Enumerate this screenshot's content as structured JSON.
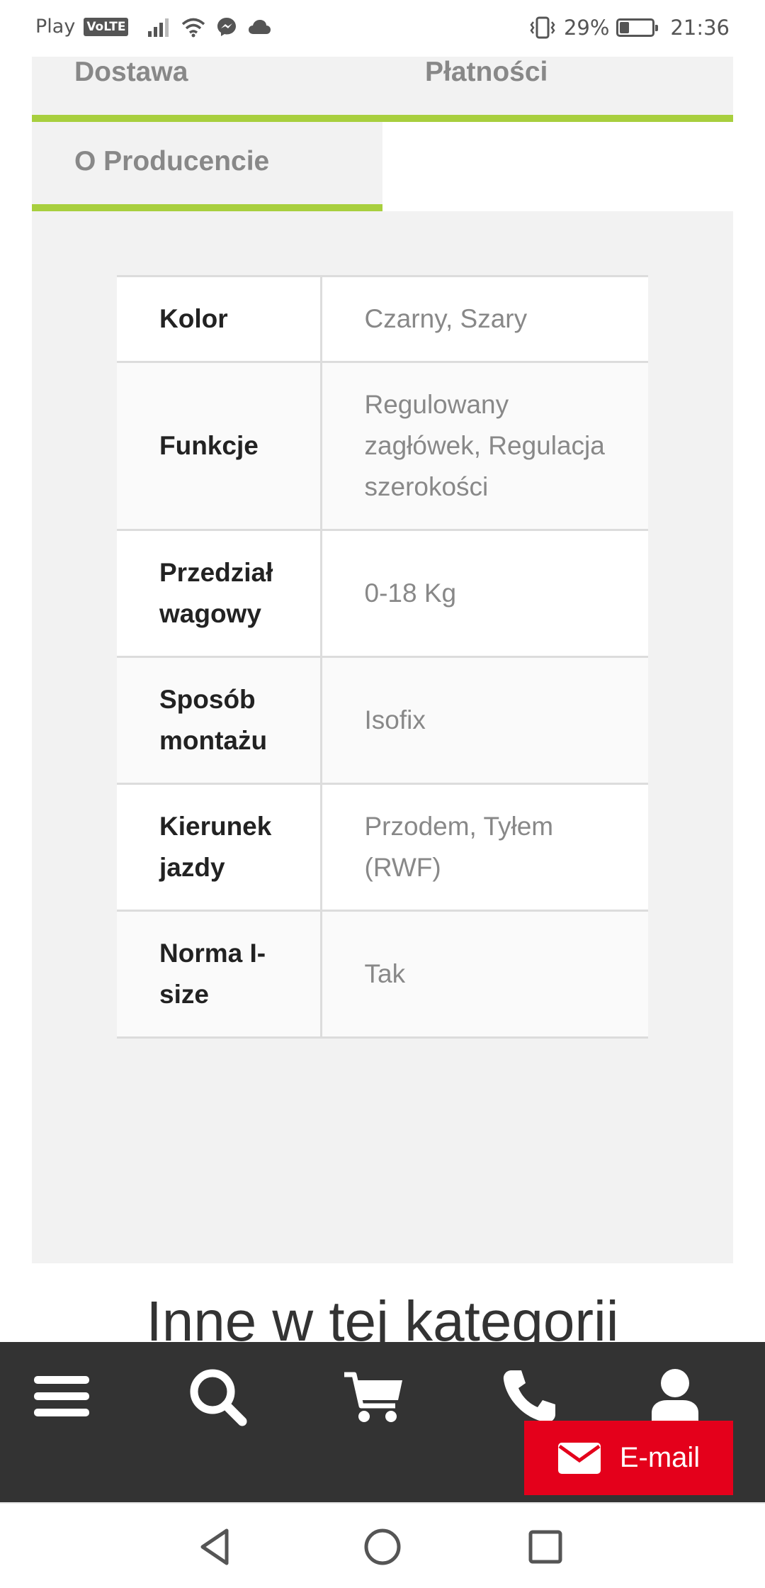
{
  "status_bar": {
    "carrier": "Play",
    "volte": "VoLTE",
    "battery_percent": "29%",
    "battery_level": 0.29,
    "time": "21:36",
    "icons": [
      "signal-icon",
      "wifi-icon",
      "messenger-icon",
      "cloud-icon",
      "vibrate-icon",
      "battery-icon"
    ]
  },
  "tabs": {
    "dostawa": "Dostawa",
    "platnosci": "Płatności",
    "producer": "O Producencie"
  },
  "specs": [
    {
      "key": "Kolor",
      "value": "Czarny, Szary"
    },
    {
      "key": "Funkcje",
      "value": "Regulowany zagłówek, Regulacja szerokości"
    },
    {
      "key": "Przedział wagowy",
      "value": "0-18 Kg"
    },
    {
      "key": "Sposób montażu",
      "value": "Isofix"
    },
    {
      "key": "Kierunek jazdy",
      "value": "Przodem, Tyłem (RWF)"
    },
    {
      "key": "Norma I-size",
      "value": "Tak"
    }
  ],
  "category_heading": "Inne w tej kategorii",
  "bottom_bar": {
    "icons": [
      "menu-icon",
      "search-icon",
      "cart-icon",
      "phone-icon",
      "user-icon"
    ],
    "email_label": "E-mail"
  },
  "colors": {
    "accent_green": "#a8cf3e",
    "bar_dark": "#333333",
    "email_red": "#e4001b"
  }
}
